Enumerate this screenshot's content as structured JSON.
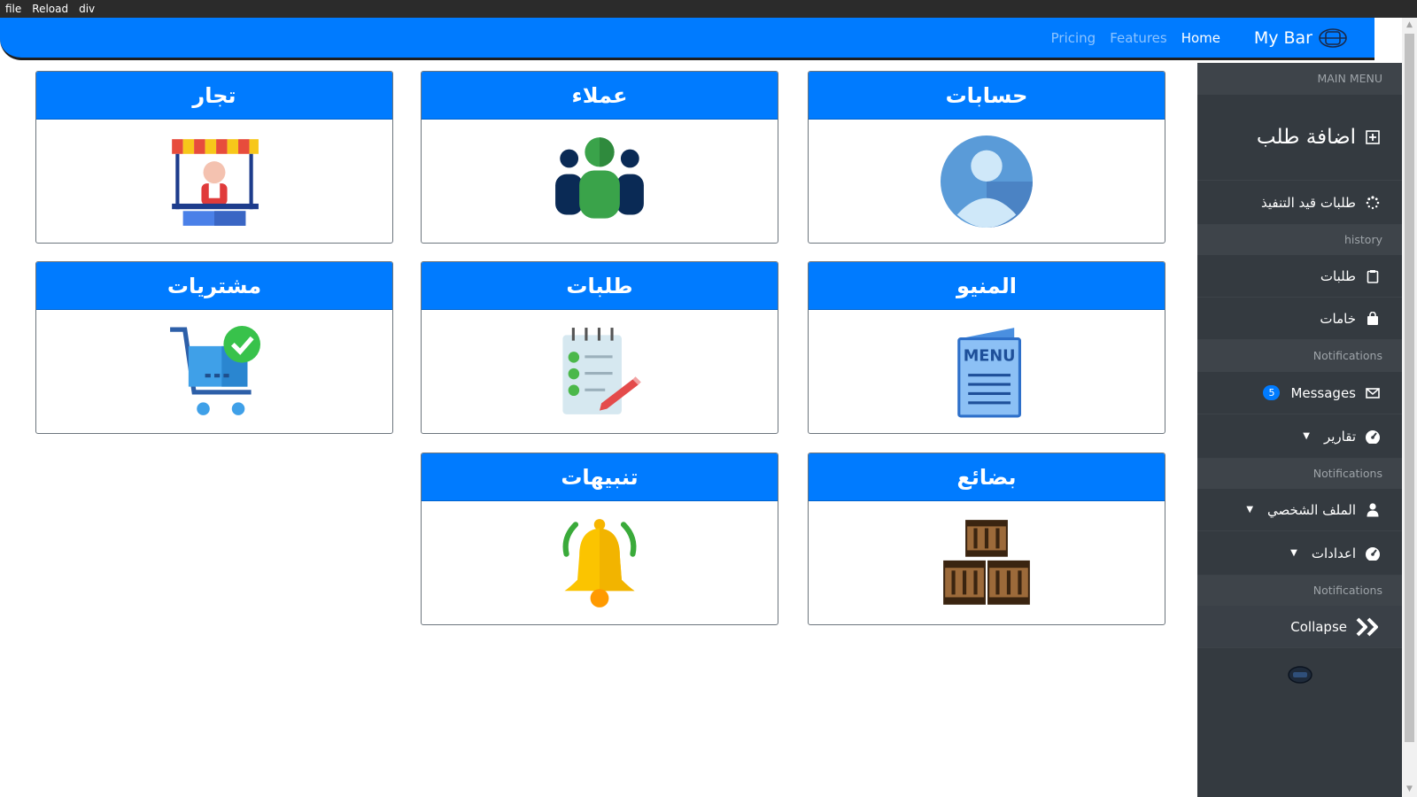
{
  "window_menu": {
    "file": "file",
    "reload": "Reload",
    "div": "div"
  },
  "navbar": {
    "brand": "My Bar",
    "links": {
      "home": "Home",
      "features": "Features",
      "pricing": "Pricing"
    }
  },
  "cards": {
    "accounts": {
      "title": "حسابات",
      "icon": "user-avatar-icon"
    },
    "customers": {
      "title": "عملاء",
      "icon": "customers-group-icon"
    },
    "merchants": {
      "title": "تجار",
      "icon": "market-stall-icon"
    },
    "menu": {
      "title": "المنيو",
      "icon": "menu-book-icon"
    },
    "orders": {
      "title": "طلبات",
      "icon": "checklist-icon"
    },
    "purchases": {
      "title": "مشتريات",
      "icon": "cart-check-icon"
    },
    "goods": {
      "title": "بضائع",
      "icon": "crates-icon"
    },
    "alerts": {
      "title": "تنبيهات",
      "icon": "bell-icon"
    }
  },
  "sidebar": {
    "main_menu": "MAIN MENU",
    "add_order": "اضافة طلب",
    "pending_orders": "طلبات قيد التنفيذ",
    "history": "history",
    "orders": "طلبات",
    "materials": "خامات",
    "notifications_1": "Notifications",
    "messages": "Messages",
    "messages_count": "5",
    "reports": "تقارير",
    "notifications_2": "Notifications",
    "profile": "الملف الشخصي",
    "settings": "اعدادات",
    "notifications_3": "Notifications",
    "collapse": "Collapse"
  },
  "colors": {
    "primary": "#007bff",
    "sidebar": "#343a40",
    "sidebar_heading": "#3e444a"
  }
}
